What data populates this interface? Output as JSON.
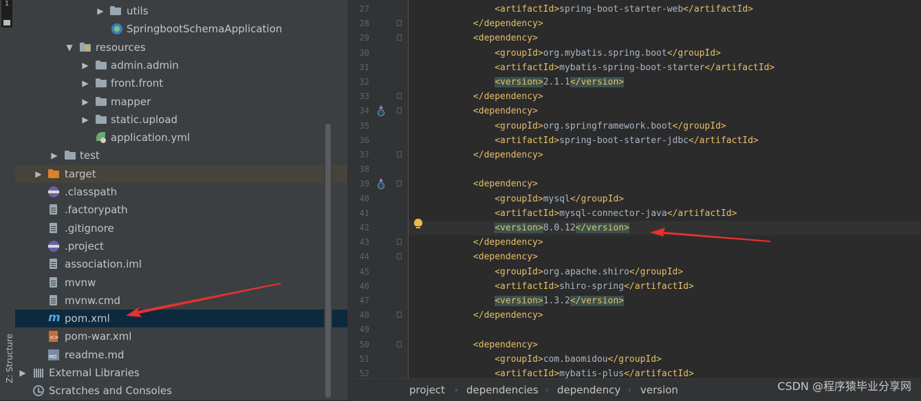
{
  "side_strip": {
    "top_tab": "1",
    "structure_label": "Z: Structure"
  },
  "project_tree": {
    "items": [
      {
        "label": "utils",
        "icon": "folder-icon",
        "arrow": "▶"
      },
      {
        "label": "SpringbootSchemaApplication",
        "icon": "spring-boot-class-icon",
        "arrow": ""
      },
      {
        "label": "resources",
        "icon": "resources-folder-icon",
        "arrow": "▼"
      },
      {
        "label": "admin.admin",
        "icon": "folder-icon",
        "arrow": "▶"
      },
      {
        "label": "front.front",
        "icon": "folder-icon",
        "arrow": "▶"
      },
      {
        "label": "mapper",
        "icon": "folder-icon",
        "arrow": "▶"
      },
      {
        "label": "static.upload",
        "icon": "folder-icon",
        "arrow": "▶"
      },
      {
        "label": "application.yml",
        "icon": "yaml-config-icon",
        "arrow": ""
      },
      {
        "label": "test",
        "icon": "folder-icon",
        "arrow": "▶"
      },
      {
        "label": "target",
        "icon": "excluded-folder-icon",
        "arrow": "▶"
      },
      {
        "label": ".classpath",
        "icon": "eclipse-icon",
        "arrow": ""
      },
      {
        "label": ".factorypath",
        "icon": "text-file-icon",
        "arrow": ""
      },
      {
        "label": ".gitignore",
        "icon": "text-file-icon",
        "arrow": ""
      },
      {
        "label": ".project",
        "icon": "eclipse-icon",
        "arrow": ""
      },
      {
        "label": "association.iml",
        "icon": "iml-file-icon",
        "arrow": ""
      },
      {
        "label": "mvnw",
        "icon": "text-file-icon",
        "arrow": ""
      },
      {
        "label": "mvnw.cmd",
        "icon": "text-file-icon",
        "arrow": ""
      },
      {
        "label": "pom.xml",
        "icon": "maven-icon",
        "arrow": ""
      },
      {
        "label": "pom-war.xml",
        "icon": "xml-file-icon",
        "arrow": ""
      },
      {
        "label": "readme.md",
        "icon": "markdown-icon",
        "arrow": ""
      },
      {
        "label": "External Libraries",
        "icon": "library-icon",
        "arrow": "▶"
      },
      {
        "label": "Scratches and Consoles",
        "icon": "scratches-icon",
        "arrow": ""
      }
    ],
    "selected": "pom.xml"
  },
  "editor": {
    "lines": [
      {
        "n": "27",
        "indent": "        ",
        "tag": "artifactId",
        "value": "spring-boot-starter-web"
      },
      {
        "n": "28",
        "indent": "    ",
        "close": "dependency"
      },
      {
        "n": "29",
        "indent": "    ",
        "open": "dependency"
      },
      {
        "n": "30",
        "indent": "        ",
        "tag": "groupId",
        "value": "org.mybatis.spring.boot"
      },
      {
        "n": "31",
        "indent": "        ",
        "tag": "artifactId",
        "value": "mybatis-spring-boot-starter"
      },
      {
        "n": "32",
        "indent": "        ",
        "tag": "version",
        "value": "2.1.1"
      },
      {
        "n": "33",
        "indent": "    ",
        "close": "dependency"
      },
      {
        "n": "34",
        "indent": "    ",
        "open": "dependency"
      },
      {
        "n": "35",
        "indent": "        ",
        "tag": "groupId",
        "value": "org.springframework.boot"
      },
      {
        "n": "36",
        "indent": "        ",
        "tag": "artifactId",
        "value": "spring-boot-starter-jdbc"
      },
      {
        "n": "37",
        "indent": "    ",
        "close": "dependency"
      },
      {
        "n": "38",
        "indent": "",
        "blank": true
      },
      {
        "n": "39",
        "indent": "    ",
        "open": "dependency"
      },
      {
        "n": "40",
        "indent": "        ",
        "tag": "groupId",
        "value": "mysql"
      },
      {
        "n": "41",
        "indent": "        ",
        "tag": "artifactId",
        "value": "mysql-connector-java"
      },
      {
        "n": "42",
        "indent": "        ",
        "tag": "version",
        "value": "8.0.12"
      },
      {
        "n": "43",
        "indent": "    ",
        "close": "dependency"
      },
      {
        "n": "44",
        "indent": "    ",
        "open": "dependency"
      },
      {
        "n": "45",
        "indent": "        ",
        "tag": "groupId",
        "value": "org.apache.shiro"
      },
      {
        "n": "46",
        "indent": "        ",
        "tag": "artifactId",
        "value": "shiro-spring"
      },
      {
        "n": "47",
        "indent": "        ",
        "tag": "version",
        "value": "1.3.2"
      },
      {
        "n": "48",
        "indent": "    ",
        "close": "dependency"
      },
      {
        "n": "49",
        "indent": "",
        "blank": true
      },
      {
        "n": "50",
        "indent": "    ",
        "open": "dependency"
      },
      {
        "n": "51",
        "indent": "        ",
        "tag": "groupId",
        "value": "com.baomidou"
      },
      {
        "n": "52",
        "indent": "        ",
        "tag": "artifactId",
        "value": "mybatis-plus"
      }
    ],
    "current_line": "42"
  },
  "breadcrumb": [
    "project",
    "dependencies",
    "dependency",
    "version"
  ],
  "watermark": "CSDN @程序猿毕业分享网",
  "colors": {
    "tag": "#e8bf6a",
    "text": "#a9b7c6",
    "selection": "#0d293e",
    "arrow": "#e8312f"
  }
}
